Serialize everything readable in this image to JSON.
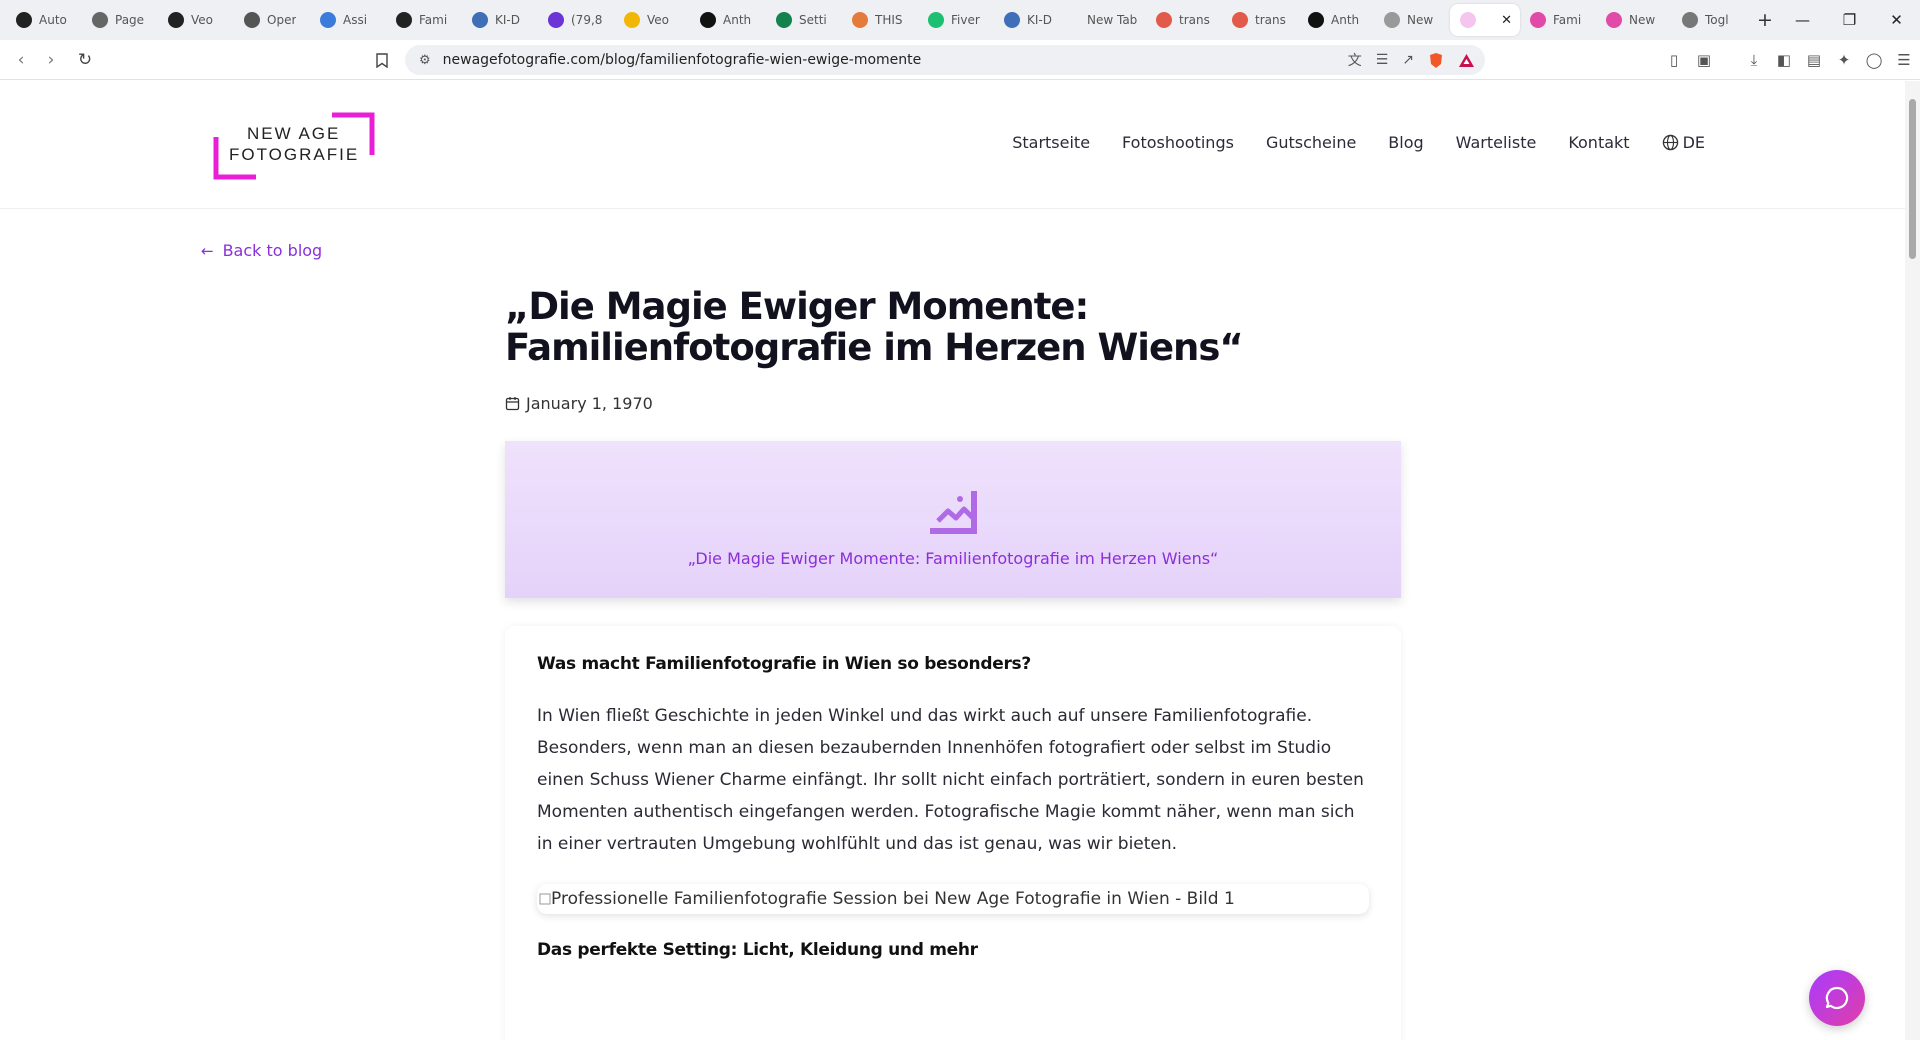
{
  "browser": {
    "tabs": [
      {
        "title": "Auto",
        "color": "#222"
      },
      {
        "title": "Page",
        "color": "#666"
      },
      {
        "title": "Veo",
        "color": "#222"
      },
      {
        "title": "Oper",
        "color": "#555"
      },
      {
        "title": "Assi",
        "color": "#3a7bdc"
      },
      {
        "title": "Fami",
        "color": "#222"
      },
      {
        "title": "KI-D",
        "color": "#3f6fb6"
      },
      {
        "title": "(79,8",
        "color": "#6a34d6"
      },
      {
        "title": "Veo",
        "color": "#f2b705"
      },
      {
        "title": "Anth",
        "color": "#111"
      },
      {
        "title": "Setti",
        "color": "#14824d"
      },
      {
        "title": "THIS",
        "color": "#e57b3a"
      },
      {
        "title": "Fiver",
        "color": "#1dbf73"
      },
      {
        "title": "KI-D",
        "color": "#3f6fb6"
      },
      {
        "title": "New Tab",
        "color": ""
      },
      {
        "title": "trans",
        "color": "#e25a4a"
      },
      {
        "title": "trans",
        "color": "#e25a4a"
      },
      {
        "title": "Anth",
        "color": "#111"
      },
      {
        "title": "New",
        "color": "#999"
      }
    ],
    "active_tab": {
      "title": "",
      "close": "✕"
    },
    "tabs_after": [
      {
        "title": "Fami",
        "color": "#e24aa8"
      },
      {
        "title": "New",
        "color": "#e24aa8"
      },
      {
        "title": "Togl",
        "color": "#777"
      }
    ],
    "new_tab": "+",
    "url": "newagefotografie.com/blog/familienfotografie-wien-ewige-momente"
  },
  "site": {
    "logo_line1": "NEW AGE",
    "logo_line2": "FOTOGRAFIE",
    "accent": "#e81fd6",
    "nav": [
      "Startseite",
      "Fotoshootings",
      "Gutscheine",
      "Blog",
      "Warteliste",
      "Kontakt"
    ],
    "lang": "DE"
  },
  "article": {
    "back_label": "Back to blog",
    "title": "„Die Magie Ewiger Momente: Familienfotografie im Herzen Wiens“",
    "date": "January 1, 1970",
    "hero_caption": "„Die Magie Ewiger Momente: Familienfotografie im Herzen Wiens“",
    "heading1": "Was macht Familienfotografie in Wien so besonders?",
    "paragraph1": "In Wien fließt Geschichte in jeden Winkel und das wirkt auch auf unsere Familienfotografie. Besonders, wenn man an diesen bezaubernden Innenhöfen fotografiert oder selbst im Studio einen Schuss Wiener Charme einfängt. Ihr sollt nicht einfach porträtiert, sondern in euren besten Momenten authentisch eingefangen werden. Fotografische Magie kommt näher, wenn man sich in einer vertrauten Umgebung wohlfühlt und das ist genau, was wir bieten.",
    "image_alt": "Professionelle Familienfotografie Session bei New Age Fotografie in Wien - Bild 1",
    "heading2": "Das perfekte Setting: Licht, Kleidung und mehr"
  }
}
